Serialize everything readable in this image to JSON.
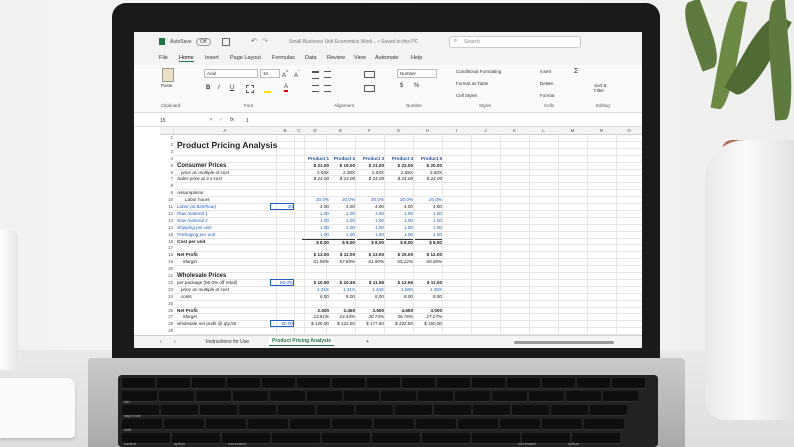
{
  "excel": {
    "autosave_label": "AutoSave",
    "autosave_state": "Off",
    "doc_title": "Small Business Unit Economics Work...  •  Saved to this PC",
    "search_placeholder": "Search",
    "menu": [
      "File",
      "Home",
      "Insert",
      "Page Layout",
      "Formulas",
      "Data",
      "Review",
      "View",
      "Automate",
      "Help"
    ],
    "active_menu": "Home",
    "ribbon": {
      "paste": "Paste",
      "clipboard": "Clipboard",
      "font_name": "Arial",
      "font_size": "10",
      "font": "Font",
      "alignment": "Alignment",
      "number_format": "Number",
      "number": "Number",
      "conditional": "Conditional Formatting",
      "format_table": "Format as Table",
      "cell_styles": "Cell Styles",
      "styles": "Styles",
      "insert": "Insert",
      "delete": "Delete",
      "format": "Format",
      "cells": "Cells",
      "sort_filter": "Sort & Filter",
      "editing": "Editing",
      "bold": "B",
      "italic": "I",
      "underline": "U",
      "dollar": "$",
      "percent": "%"
    },
    "name_box": "15",
    "fx": "fx",
    "formula_value": "1",
    "columns": [
      "A",
      "B",
      "C",
      "D",
      "E",
      "F",
      "G",
      "H",
      "I",
      "J",
      "K",
      "L",
      "M",
      "N",
      "O"
    ],
    "rows": [
      "1",
      "2",
      "3",
      "4",
      "5",
      "6",
      "7",
      "8",
      "9",
      "10",
      "11",
      "12",
      "13",
      "14",
      "15",
      "16",
      "17",
      "18",
      "19",
      "20",
      "21",
      "22",
      "23",
      "24",
      "25",
      "26",
      "27",
      "28",
      "29"
    ],
    "sheet": {
      "title": "Product Pricing Analysis",
      "products": [
        "Product 1",
        "Product 2",
        "Product 3",
        "Product 4",
        "Product 5"
      ],
      "consumer_prices": "Consumer Prices",
      "consumer_prices_vals": [
        "$  21.00",
        "$  19.00",
        "$  21.00",
        "$  23.00",
        "$  20.00"
      ],
      "price_multiple": "price as multiple of cost",
      "price_multiple_vals": [
        "2.63X",
        "2.38X",
        "2.63X",
        "2.88X",
        "2.50X"
      ],
      "sales_price": "Sales price at 3 x cost",
      "sales_price_vals": [
        "$  24.00",
        "$  24.00",
        "$  24.00",
        "$  24.00",
        "$  24.00"
      ],
      "assumptions": "Assumptions",
      "labor_hours": "Labor hours",
      "labor_hours_vals": [
        "20.0%",
        "20.0%",
        "20.0%",
        "20.0%",
        "20.0%"
      ],
      "labor_cost": "Labor (at $20/hour)",
      "labor_rate": "20",
      "labor_cost_vals": [
        "4.00",
        "4.00",
        "4.00",
        "4.00",
        "4.00"
      ],
      "raw1": "Raw material 1",
      "raw1_vals": [
        "1.00",
        "1.00",
        "1.00",
        "1.00",
        "1.00"
      ],
      "raw2": "Raw material 2",
      "raw2_vals": [
        "1.00",
        "1.00",
        "1.00",
        "1.00",
        "1.00"
      ],
      "shipping": "Shipping per unit",
      "shipping_vals": [
        "1.00",
        "1.00",
        "1.00",
        "1.00",
        "1.00"
      ],
      "packaging": "Packaging per unit",
      "packaging_vals": [
        "1.00",
        "1.00",
        "1.00",
        "1.00",
        "1.00"
      ],
      "cost_per_unit": "Cost per unit",
      "cost_per_unit_vals": [
        "$  8.00",
        "$  8.00",
        "$  8.00",
        "$  8.00",
        "$  8.00"
      ],
      "net_profit": "Net Profit",
      "net_profit_vals": [
        "$  13.00",
        "$  11.00",
        "$  13.00",
        "$  15.00",
        "$  12.00"
      ],
      "margin": "Margin",
      "margin_vals": [
        "61.90%",
        "57.89%",
        "61.90%",
        "65.22%",
        "60.00%"
      ],
      "wholesale_prices": "Wholesale Prices",
      "per_package": "per package (50.0% off retail)",
      "per_package_rate": "50.0%",
      "per_package_vals": [
        "$  10.50",
        "$  10.45",
        "$  11.55",
        "$  12.65",
        "$  11.00"
      ],
      "ws_multiple": "price as multiple of cost",
      "ws_multiple_vals": [
        "1.31X",
        "1.31X",
        "1.44X",
        "1.58X",
        "1.38X"
      ],
      "costs": "costs",
      "costs_vals": [
        "8.00",
        "8.00",
        "8.00",
        "8.00",
        "8.00"
      ],
      "net_profit2": "Net Profit",
      "net_profit2_vals": [
        "2.500",
        "2.450",
        "3.550",
        "4.650",
        "3.000"
      ],
      "margin2": "Margin",
      "margin2_vals": [
        "23.81%",
        "23.44%",
        "30.74%",
        "36.76%",
        "27.27%"
      ],
      "ws_net": "wholesale net profit @ qty:50",
      "ws_net_qty": "50.00",
      "ws_net_vals": [
        "$ 125.00",
        "$ 122.50",
        "$ 177.50",
        "$ 232.50",
        "$ 150.00"
      ]
    },
    "tabs": [
      "Instructions for Use",
      "Product Pricing Analysis"
    ],
    "active_tab": "Product Pricing Analysis",
    "add_sheet": "+"
  },
  "keyboard": {
    "labels": [
      "tab",
      "caps lock",
      "shift",
      "control",
      "option",
      "command",
      "command",
      "option"
    ]
  }
}
